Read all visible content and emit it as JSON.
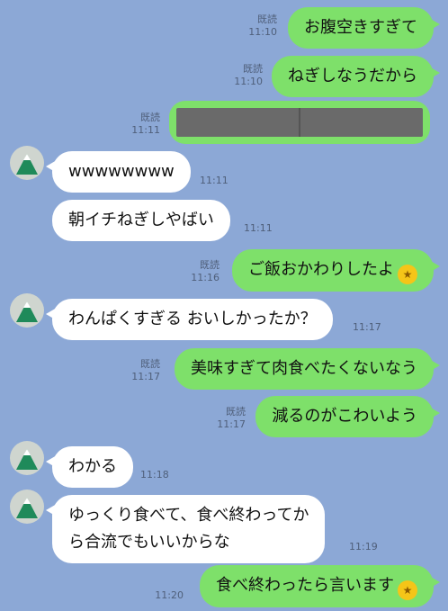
{
  "messages": [
    {
      "side": "me",
      "text": "お腹空きすぎて",
      "read": "既読",
      "time": "11:10"
    },
    {
      "side": "me",
      "text": "ねぎしなうだから",
      "read": "既読",
      "time": "11:10"
    },
    {
      "side": "me",
      "type": "image",
      "read": "既読",
      "time": "11:11"
    },
    {
      "side": "them",
      "text": "wwwwwwww",
      "time": "11:11"
    },
    {
      "side": "them",
      "text": "朝イチねぎしやばい",
      "time": "11:11"
    },
    {
      "side": "me",
      "text": "ご飯おかわりしたよ",
      "emoji": "star-struck",
      "read": "既読",
      "time": "11:16"
    },
    {
      "side": "them",
      "text": "わんぱくすぎる おいしかったか？",
      "time": "11:17"
    },
    {
      "side": "me",
      "text": "美味すぎて肉食べたくないなう",
      "read": "既読",
      "time": "11:17"
    },
    {
      "side": "me",
      "text": "減るのがこわいよう",
      "read": "既読",
      "time": "11:17"
    },
    {
      "side": "them",
      "text": "わかる",
      "time": "11:18"
    },
    {
      "side": "them",
      "text_line1": "ゆっくり食べて、食べ終わってか",
      "text_line2": "ら合流でもいいからな",
      "time": "11:19"
    },
    {
      "side": "me",
      "text": "食べ終わったら言います",
      "emoji": "star-struck",
      "time": "11:20"
    }
  ],
  "colors": {
    "background": "#8ca8d6",
    "my_bubble": "#7ee06a",
    "their_bubble": "#ffffff"
  }
}
